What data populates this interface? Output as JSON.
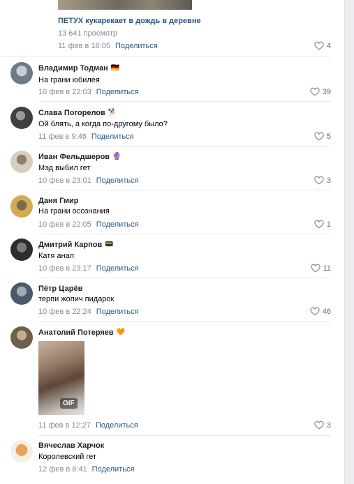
{
  "video": {
    "title": "ПЕТУХ кукарекает в дождь в деревне",
    "views": "13 641 просмотр",
    "date": "11 фев в 16:05",
    "share": "Поделиться",
    "likes": "4"
  },
  "comments": [
    {
      "author": "Владимир Тодман",
      "badge": "🇩🇪",
      "text": "На грани юбилея",
      "date": "10 фев в 22:03",
      "share": "Поделиться",
      "likes": "39",
      "avatar_color": "#6f7b86"
    },
    {
      "author": "Слава Погорелов",
      "badge": "🐕",
      "text": "Ой блять, а когда по-другому было?",
      "date": "11 фев в 9:46",
      "share": "Поделиться",
      "likes": "5",
      "avatar_color": "#5a5a5a"
    },
    {
      "author": "Иван Фельдшеров",
      "badge": "🔮",
      "text": "Мэд выбил гет",
      "date": "10 фев в 23:01",
      "share": "Поделиться",
      "likes": "3",
      "avatar_color": "#b9a895"
    },
    {
      "author": "Даня Гмир",
      "badge": "",
      "text": "На грани осознания",
      "date": "10 фев в 22:05",
      "share": "Поделиться",
      "likes": "1",
      "avatar_color": "#c9a04a"
    },
    {
      "author": "Дмитрий Карпов",
      "badge": "📟",
      "text": "Катя анал",
      "date": "10 фев в 23:17",
      "share": "Поделиться",
      "likes": "11",
      "avatar_color": "#3d3d3d"
    },
    {
      "author": "Пётр Царёв",
      "badge": "",
      "text": "терпи жопич пидарок",
      "date": "10 фев в 22:24",
      "share": "Поделиться",
      "likes": "46",
      "avatar_color": "#4a5a6a"
    },
    {
      "author": "Анатолий Потеряев",
      "badge": "🧡",
      "text": "GIF",
      "date": "11 фев в 12:27",
      "share": "Поделиться",
      "likes": "3",
      "avatar_color": "#8a7a62"
    },
    {
      "author": "Вячеслав Харчок",
      "badge": "",
      "text": "Королевский гет",
      "date": "12 фев в 8:41",
      "share": "Поделиться",
      "likes": "",
      "avatar_color": "#e8a35a"
    }
  ],
  "icons": {
    "like": "heart-outline-icon"
  }
}
